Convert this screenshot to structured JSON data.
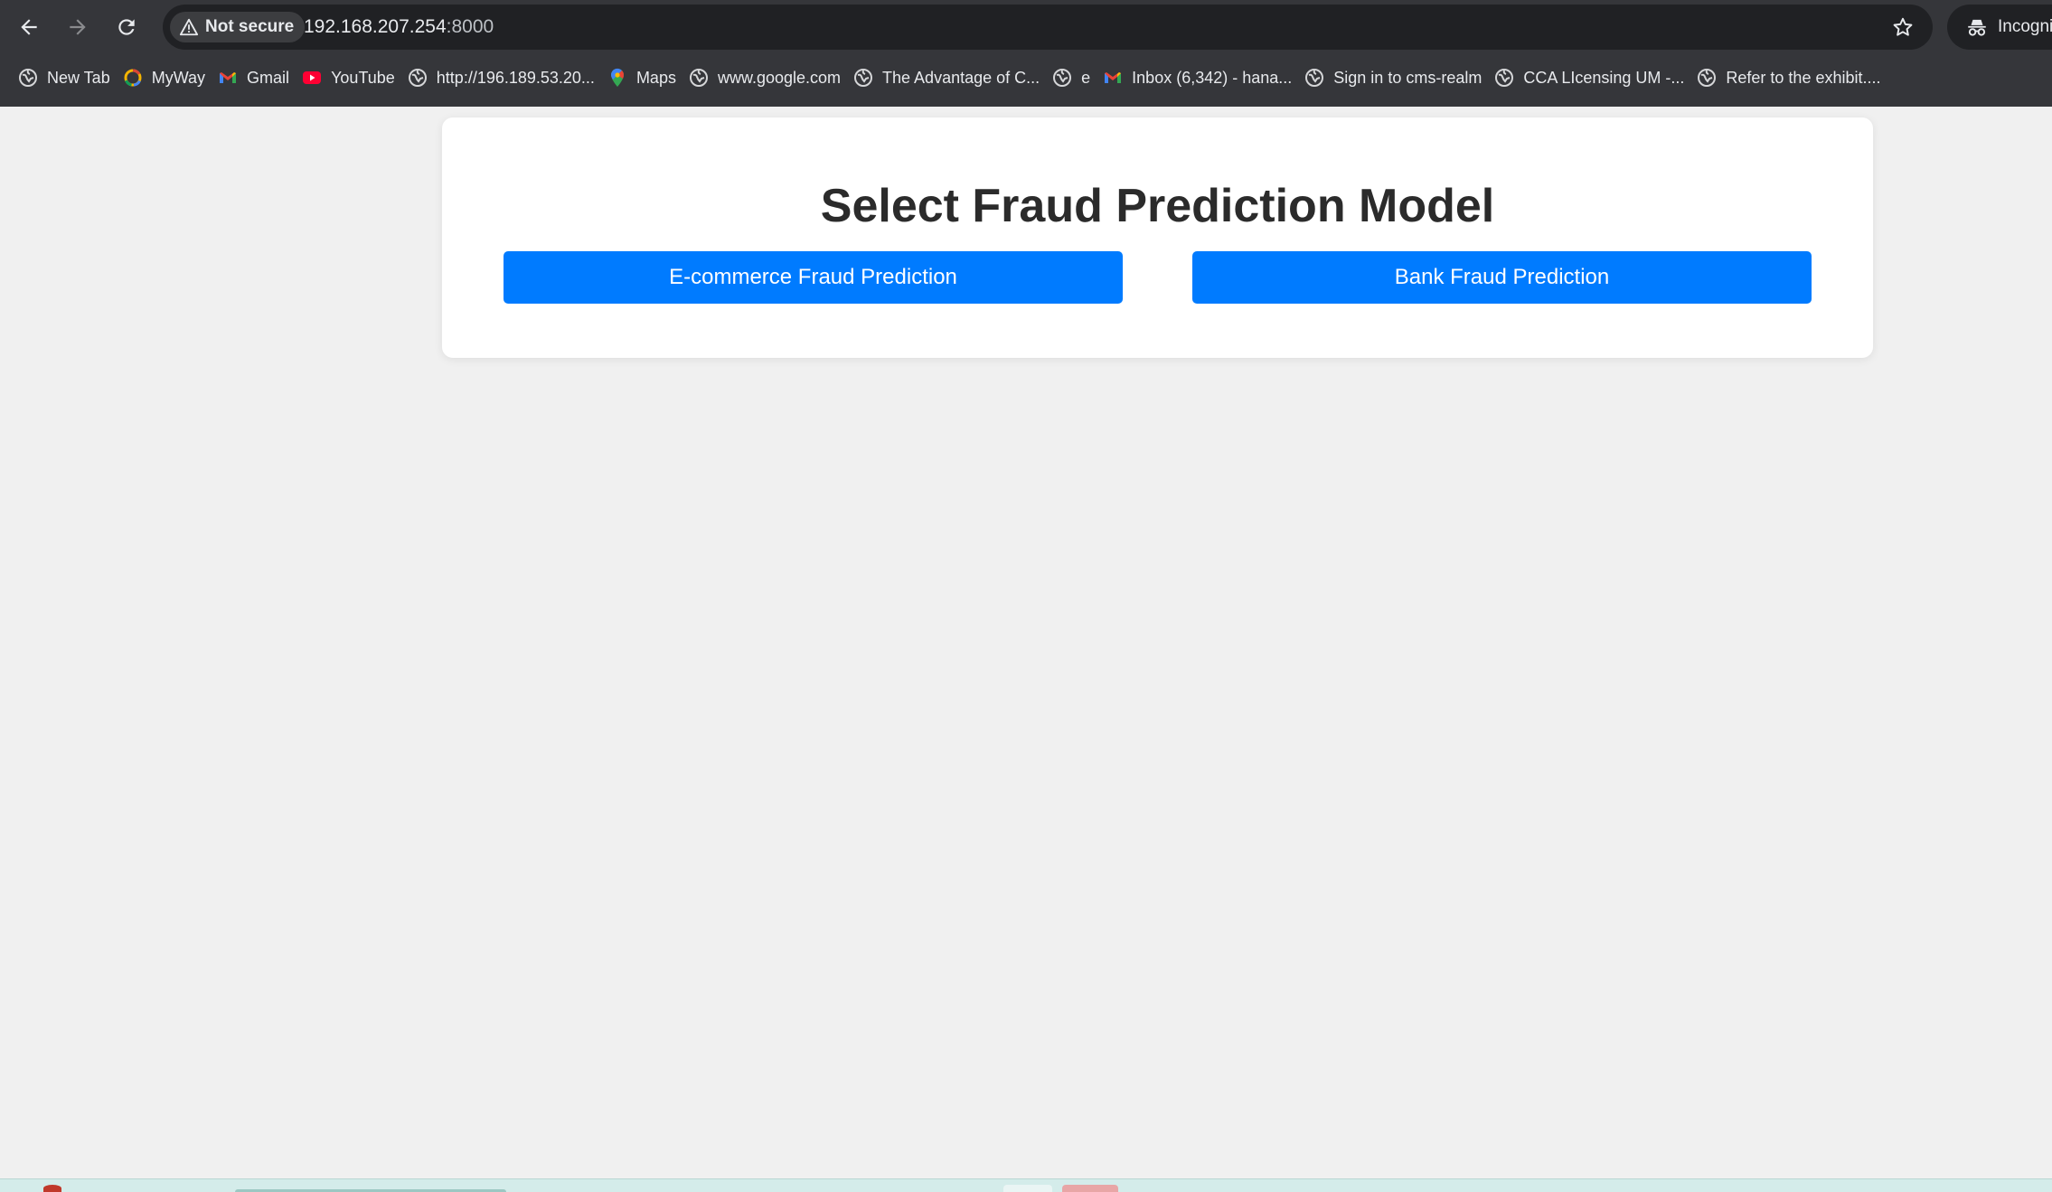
{
  "browser": {
    "security_label": "Not secure",
    "url_host": "192.168.207.254",
    "url_port": ":8000",
    "incognito_label": "Incognito"
  },
  "bookmarks": [
    {
      "label": "New Tab",
      "icon": "globe-icon"
    },
    {
      "label": "MyWay",
      "icon": "myway-icon"
    },
    {
      "label": "Gmail",
      "icon": "gmail-icon"
    },
    {
      "label": "YouTube",
      "icon": "youtube-icon"
    },
    {
      "label": "http://196.189.53.20...",
      "icon": "globe-icon"
    },
    {
      "label": "Maps",
      "icon": "maps-icon"
    },
    {
      "label": "www.google.com",
      "icon": "globe-icon"
    },
    {
      "label": "The Advantage of C...",
      "icon": "globe-icon"
    },
    {
      "label": "e",
      "icon": "globe-icon"
    },
    {
      "label": "Inbox (6,342) - hana...",
      "icon": "gmail-icon"
    },
    {
      "label": "Sign in to cms-realm",
      "icon": "globe-icon"
    },
    {
      "label": "CCA LIcensing UM -...",
      "icon": "globe-icon"
    },
    {
      "label": "Refer to the exhibit....",
      "icon": "globe-icon"
    }
  ],
  "main": {
    "title": "Select Fraud Prediction Model",
    "ecommerce_button": "E-commerce Fraud Prediction",
    "bank_button": "Bank Fraud Prediction"
  },
  "colors": {
    "primary_button": "#007bff",
    "page_background": "#f0f0f0",
    "browser_chrome": "#35363a"
  }
}
